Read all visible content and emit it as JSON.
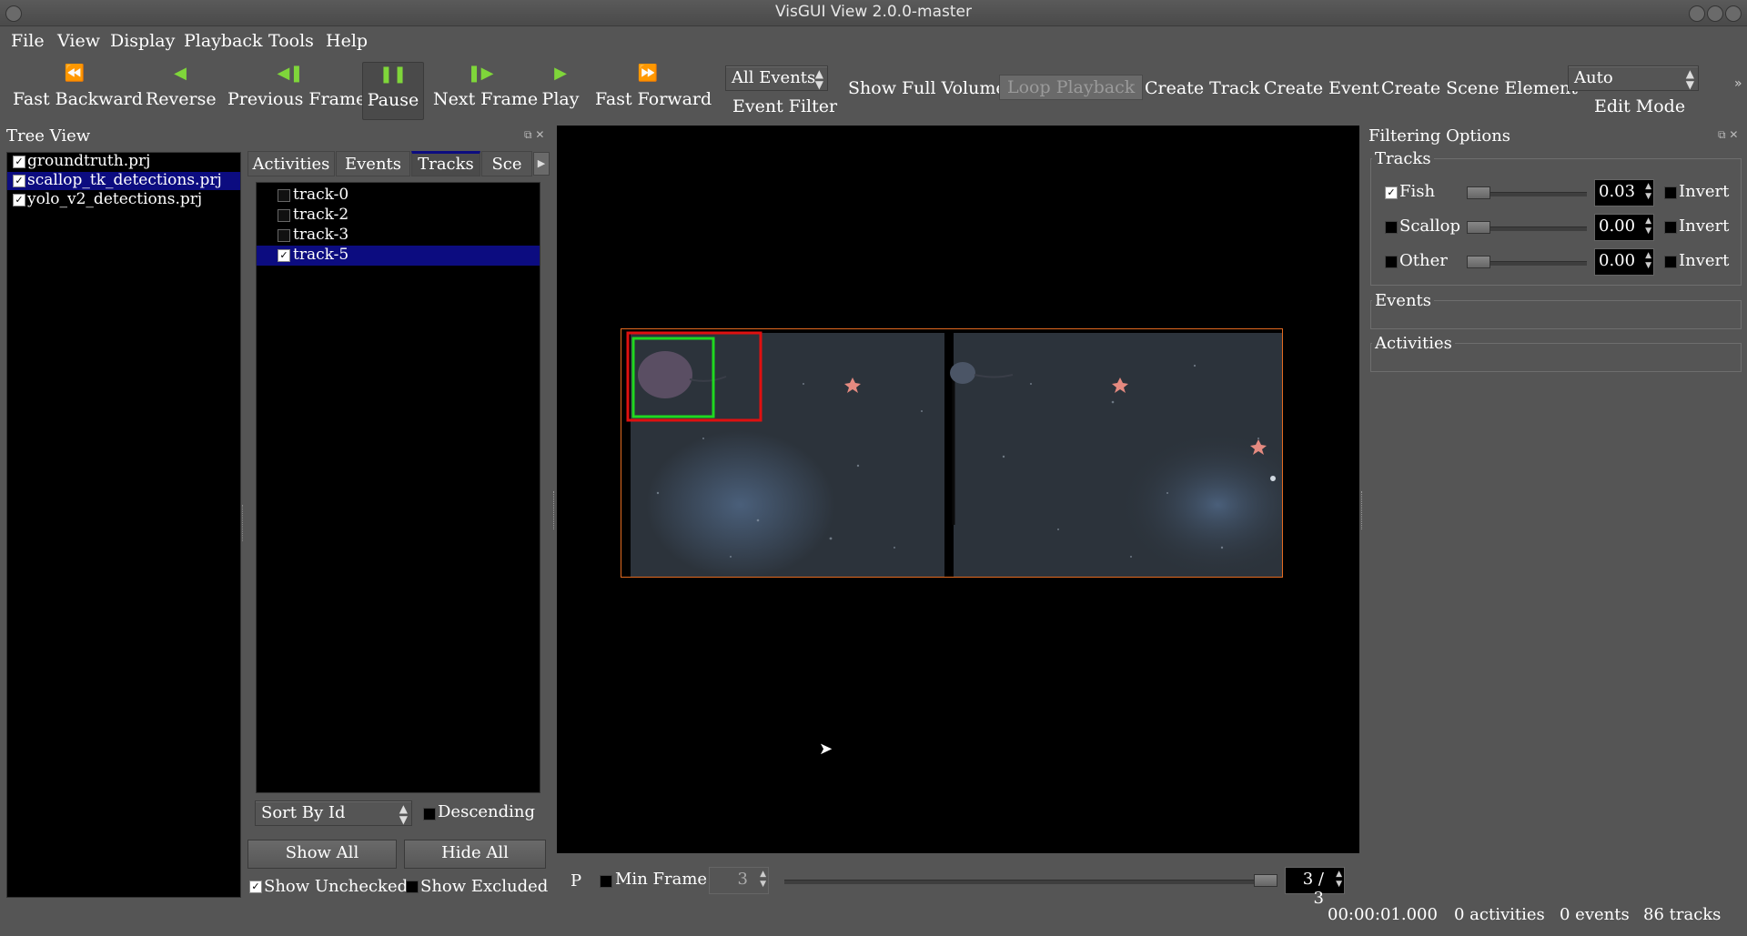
{
  "window": {
    "title": "VisGUI View 2.0.0-master"
  },
  "menu": [
    "File",
    "View",
    "Display",
    "Playback",
    "Tools",
    "Help"
  ],
  "toolbar": {
    "playback": [
      {
        "label": "Fast Backward",
        "icon": "⏪"
      },
      {
        "label": "Reverse",
        "icon": "◀"
      },
      {
        "label": "Previous Frame",
        "icon": "◀❚"
      },
      {
        "label": "Pause",
        "icon": "❚❚"
      },
      {
        "label": "Next Frame",
        "icon": "❚▶"
      },
      {
        "label": "Play",
        "icon": "▶"
      },
      {
        "label": "Fast Forward",
        "icon": "⏩"
      }
    ],
    "event_filter": {
      "value": "All Events",
      "label": "Event Filter"
    },
    "show_full_volume": "Show Full Volume",
    "loop_playback": "Loop Playback",
    "create_track": "Create Track",
    "create_event": "Create Event",
    "create_scene_element": "Create Scene Element",
    "edit_mode": {
      "value": "Auto",
      "label": "Edit Mode"
    },
    "overflow": "»"
  },
  "tree_view": {
    "title": "Tree View",
    "items": [
      {
        "label": "groundtruth.prj",
        "checked": true,
        "selected": false
      },
      {
        "label": "scallop_tk_detections.prj",
        "checked": true,
        "selected": true
      },
      {
        "label": "yolo_v2_detections.prj",
        "checked": true,
        "selected": false
      }
    ]
  },
  "tabs": [
    "Activities",
    "Events",
    "Tracks",
    "Sce"
  ],
  "tracks": [
    {
      "label": "track-0",
      "checked": false,
      "selected": false
    },
    {
      "label": "track-2",
      "checked": false,
      "selected": false
    },
    {
      "label": "track-3",
      "checked": false,
      "selected": false
    },
    {
      "label": "track-5",
      "checked": true,
      "selected": true
    }
  ],
  "list_controls": {
    "sort_by": "Sort By Id",
    "descending": "Descending",
    "show_all": "Show All",
    "hide_all": "Hide All",
    "show_unchecked": "Show Unchecked",
    "show_excluded": "Show Excluded"
  },
  "filtering": {
    "title": "Filtering Options",
    "tracks_title": "Tracks",
    "rows": [
      {
        "label": "Fish",
        "checked": true,
        "value": "0.03",
        "invert": "Invert"
      },
      {
        "label": "Scallop",
        "checked": false,
        "value": "0.00",
        "invert": "Invert"
      },
      {
        "label": "Other",
        "checked": false,
        "value": "0.00",
        "invert": "Invert"
      }
    ],
    "events_title": "Events",
    "activities_title": "Activities"
  },
  "frame_controls": {
    "p_label": "P",
    "min_frame_label": "Min Frame",
    "min_frame_value": "3",
    "frame_counter": "3 / 3"
  },
  "status": {
    "time": "00:00:01.000",
    "activities": "0 activities",
    "events": "0 events",
    "tracks": "86 tracks"
  },
  "colors": {
    "selection": "#0c0c80",
    "play_icon": "#7fd63a",
    "frame_border": "#e36a20",
    "detection_red": "#e01010",
    "detection_green": "#20d820"
  }
}
